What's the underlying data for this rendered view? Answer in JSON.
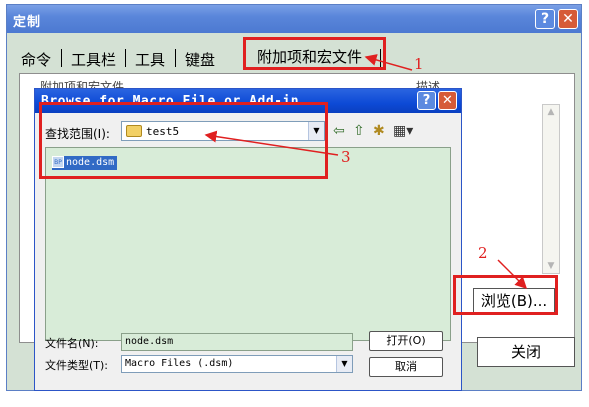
{
  "outer": {
    "title": "定制",
    "help_glyph": "?",
    "close_glyph": "✕",
    "tabs": [
      {
        "label": "命令"
      },
      {
        "label": "工具栏"
      },
      {
        "label": "工具"
      },
      {
        "label": "键盘"
      },
      {
        "label": "附加项和宏文件"
      }
    ],
    "panel_hint_left": "附加项和宏文件",
    "panel_hint_right": "描述",
    "browse_label": "浏览(B)...",
    "close_label": "关闭"
  },
  "inner": {
    "title": "Browse for Macro File or Add-in",
    "help_glyph": "?",
    "close_glyph": "✕",
    "lookin_label": "查找范围(I):",
    "lookin_value": "test5",
    "file_icon_text": "BP",
    "files": [
      {
        "name": "node.dsm",
        "selected": true
      }
    ],
    "filename_label": "文件名(N):",
    "filename_value": "node.dsm",
    "filetype_label": "文件类型(T):",
    "filetype_value": "Macro Files (.dsm)",
    "open_label": "打开(O)",
    "cancel_label": "取消"
  },
  "annotations": [
    {
      "number": "1"
    },
    {
      "number": "2"
    },
    {
      "number": "3"
    }
  ],
  "colors": {
    "annotation": "#e02020",
    "outer_title": "#5a86da",
    "inner_title": "#0d4ad6",
    "selection": "#316ac5",
    "list_bg": "#d8ecd8"
  }
}
